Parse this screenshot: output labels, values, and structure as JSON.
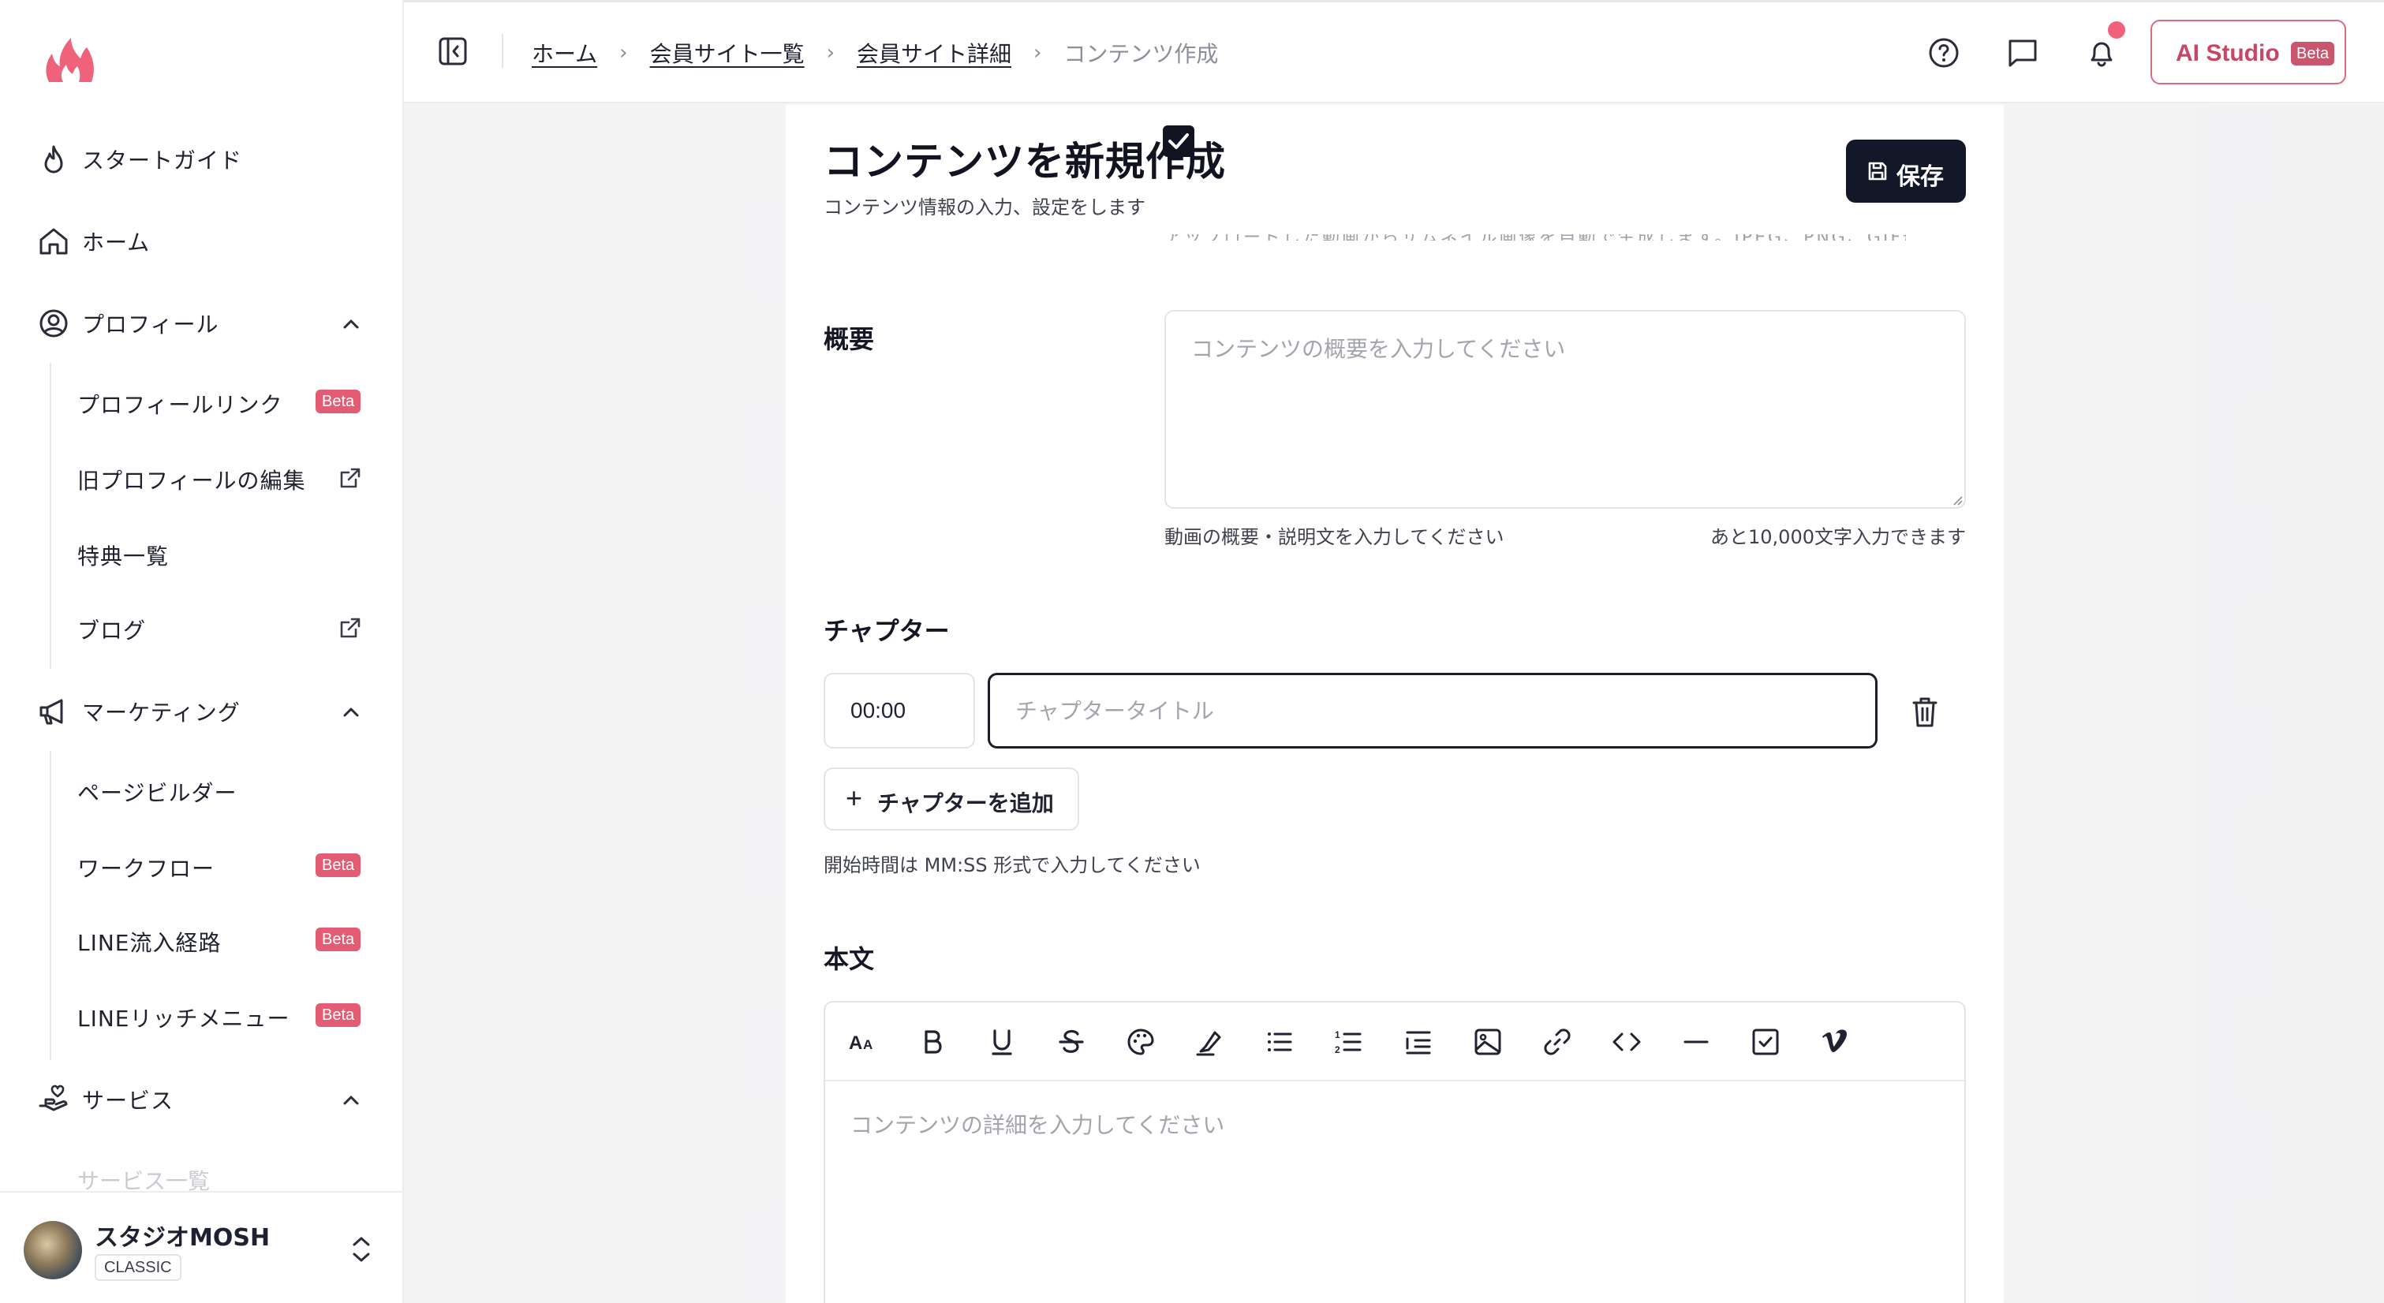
{
  "sidebar": {
    "items": [
      {
        "label": "スタートガイド"
      },
      {
        "label": "ホーム"
      },
      {
        "label": "プロフィール"
      },
      {
        "label": "マーケティング"
      },
      {
        "label": "サービス"
      }
    ],
    "profile_sub": [
      {
        "label": "プロフィールリンク",
        "badge": "Beta"
      },
      {
        "label": "旧プロフィールの編集"
      },
      {
        "label": "特典一覧"
      },
      {
        "label": "ブログ"
      }
    ],
    "marketing_sub": [
      {
        "label": "ページビルダー"
      },
      {
        "label": "ワークフロー",
        "badge": "Beta"
      },
      {
        "label": "LINE流入経路",
        "badge": "Beta"
      },
      {
        "label": "LINEリッチメニュー",
        "badge": "Beta"
      }
    ],
    "service_sub_partial": "サービス一覧",
    "user": {
      "name": "スタジオMOSH",
      "plan": "CLASSIC"
    }
  },
  "header": {
    "breadcrumb": [
      {
        "label": "ホーム"
      },
      {
        "label": "会員サイト一覧"
      },
      {
        "label": "会員サイト詳細"
      },
      {
        "label": "コンテンツ作成"
      }
    ],
    "ai_studio": {
      "label": "AI Studio",
      "badge": "Beta"
    }
  },
  "page": {
    "title": "コンテンツを新規作成",
    "subtitle": "コンテンツ情報の入力、設定をします",
    "save_label": "保存",
    "clipped_text": "アップロードした動画からサムネイル画像を自動で生成します。JPEG、PNG、GIF形式がアップロードできます"
  },
  "summary": {
    "label": "概要",
    "placeholder": "コンテンツの概要を入力してください",
    "value": "",
    "help": "動画の概要・説明文を入力してください",
    "counter": "あと10,000文字入力できます"
  },
  "chapter": {
    "label": "チャプター",
    "time_value": "00:00",
    "title_placeholder": "チャプタータイトル",
    "add_label": "チャプターを追加",
    "help": "開始時間は MM:SS 形式で入力してください"
  },
  "body": {
    "label": "本文",
    "placeholder": "コンテンツの詳細を入力してください",
    "toolbar": [
      "font-size-icon",
      "bold-icon",
      "underline-icon",
      "strikethrough-icon",
      "palette-icon",
      "highlighter-icon",
      "bullet-list-icon",
      "numbered-list-icon",
      "indent-list-icon",
      "image-icon",
      "link-icon",
      "code-icon",
      "horizontal-rule-icon",
      "checkbox-icon",
      "vimeo-icon"
    ]
  },
  "colors": {
    "brand": "#f0617a",
    "accent_dark": "#131829",
    "badge": "#e25c74"
  }
}
